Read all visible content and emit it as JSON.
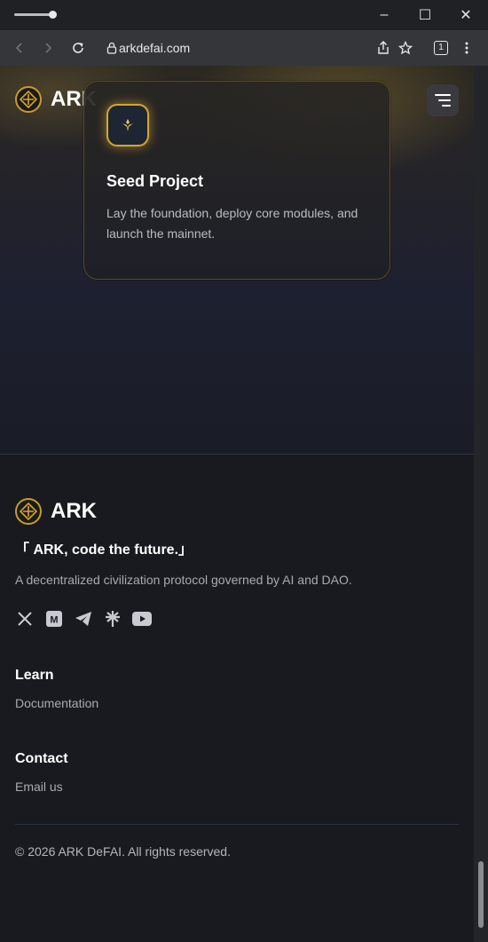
{
  "browser": {
    "url": "arkdefai.com",
    "tab_count": "1",
    "window_controls": {
      "minimize": "–",
      "maximize": "☐",
      "close": "✕"
    }
  },
  "header": {
    "logo_text": "ARK",
    "menu_icon": "menu-icon"
  },
  "card": {
    "icon": "seed-icon",
    "title": "Seed Project",
    "description": "Lay the foundation, deploy core modules, and launch the mainnet."
  },
  "footer": {
    "logo_text": "ARK",
    "tagline": "「 ARK, code the future.」",
    "description": "A decentralized civilization protocol governed by AI and DAO.",
    "socials": [
      "x-icon",
      "medium-icon",
      "telegram-icon",
      "linktree-icon",
      "youtube-icon"
    ],
    "sections": [
      {
        "title": "Learn",
        "links": [
          "Documentation"
        ]
      },
      {
        "title": "Contact",
        "links": [
          "Email us"
        ]
      }
    ],
    "copyright": "© 2026 ARK DeFAI. All rights reserved."
  },
  "colors": {
    "accent_gold": "#d7a52f",
    "background": "#191a1f",
    "muted_text": "#a8abb3"
  }
}
